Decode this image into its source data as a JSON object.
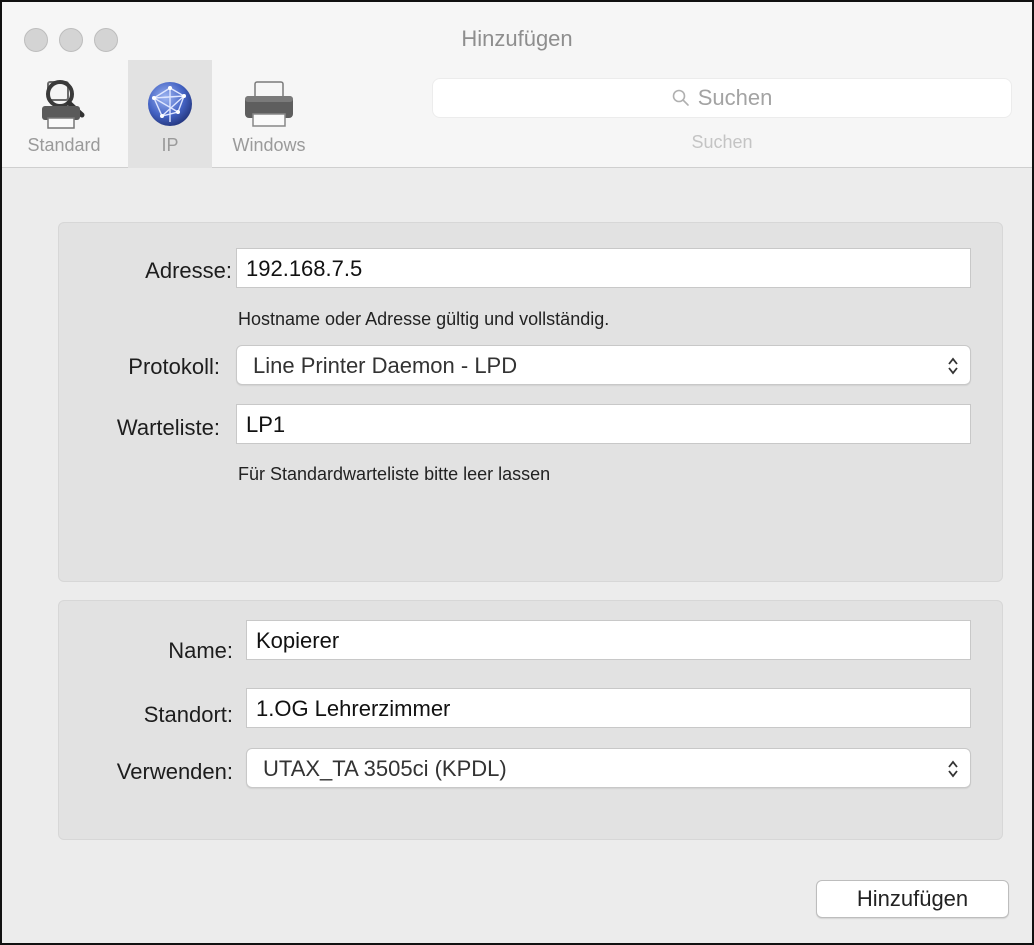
{
  "window": {
    "title": "Hinzufügen"
  },
  "toolbar": {
    "tabs": [
      {
        "label": "Standard",
        "icon": "magnifier-printer-icon"
      },
      {
        "label": "IP",
        "icon": "globe-icon",
        "selected": true
      },
      {
        "label": "Windows",
        "icon": "printer-icon"
      }
    ],
    "search": {
      "placeholder": "Suchen",
      "label": "Suchen"
    }
  },
  "connection": {
    "address_label": "Adresse:",
    "address_value": "192.168.7.5",
    "address_hint": "Hostname oder Adresse gültig und vollständig.",
    "protocol_label": "Protokoll:",
    "protocol_value": "Line Printer Daemon - LPD",
    "queue_label": "Warteliste:",
    "queue_value": "LP1",
    "queue_hint": "Für Standardwarteliste bitte leer lassen"
  },
  "printer": {
    "name_label": "Name:",
    "name_value": "Kopierer",
    "location_label": "Standort:",
    "location_value": "1.OG Lehrerzimmer",
    "driver_label": "Verwenden:",
    "driver_value": "UTAX_TA 3505ci (KPDL)"
  },
  "actions": {
    "add_label": "Hinzufügen"
  }
}
